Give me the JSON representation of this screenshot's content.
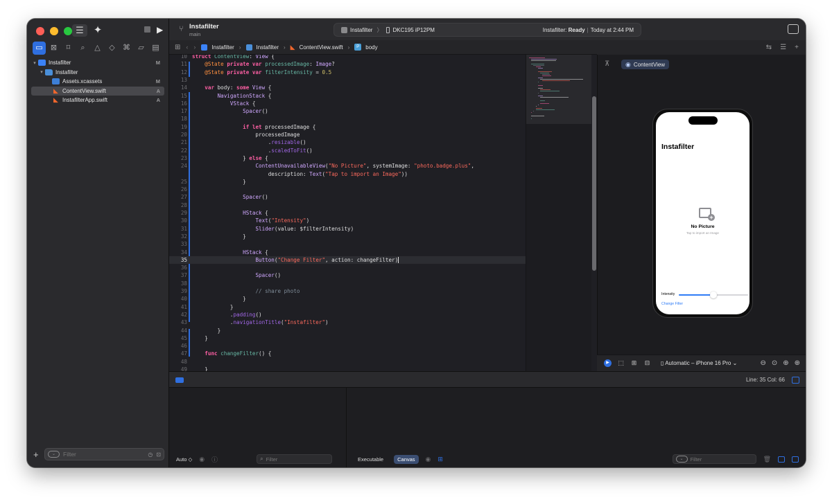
{
  "sidebar": {
    "tree": [
      {
        "label": "Instafilter",
        "icon": "project-icon",
        "badge": "M",
        "depth": 0,
        "expanded": true
      },
      {
        "label": "Instafilter",
        "icon": "folder-icon",
        "badge": "",
        "depth": 1,
        "expanded": true
      },
      {
        "label": "Assets.xcassets",
        "icon": "assets-icon",
        "badge": "M",
        "depth": 2
      },
      {
        "label": "ContentView.swift",
        "icon": "swift-file-icon",
        "badge": "A",
        "depth": 2,
        "selected": true
      },
      {
        "label": "InstafilterApp.swift",
        "icon": "swift-file-icon",
        "badge": "A",
        "depth": 2
      }
    ],
    "filter_placeholder": "Filter",
    "nav_icons": [
      "folder-icon",
      "source-control-icon",
      "bookmark-icon",
      "find-icon",
      "issue-icon",
      "test-icon",
      "debug-icon",
      "breakpoint-icon",
      "report-icon"
    ]
  },
  "toolbar": {
    "project_title": "Instafilter",
    "branch": "main",
    "scheme": "Instafilter",
    "device": "DKC195 iP12PM",
    "status_prefix": "Instafilter:",
    "status_state": "Ready",
    "status_time": "Today at 2:44 PM"
  },
  "jumpbar": {
    "crumbs": [
      "Instafilter",
      "Instafilter",
      "ContentView.swift",
      "body"
    ]
  },
  "editor": {
    "current_line": 35,
    "lines": [
      {
        "n": 10,
        "text": "struct ContentView: View {"
      },
      {
        "n": 11,
        "text": "    @State private var processedImage: Image?"
      },
      {
        "n": 12,
        "text": "    @State private var filterIntensity = 0.5"
      },
      {
        "n": 13,
        "text": ""
      },
      {
        "n": 14,
        "text": "    var body: some View {"
      },
      {
        "n": 15,
        "text": "        NavigationStack {"
      },
      {
        "n": 16,
        "text": "            VStack {"
      },
      {
        "n": 17,
        "text": "                Spacer()"
      },
      {
        "n": 18,
        "text": ""
      },
      {
        "n": 19,
        "text": "                if let processedImage {"
      },
      {
        "n": 20,
        "text": "                    processedImage"
      },
      {
        "n": 21,
        "text": "                        .resizable()"
      },
      {
        "n": 22,
        "text": "                        .scaledToFit()"
      },
      {
        "n": 23,
        "text": "                } else {"
      },
      {
        "n": 24,
        "text": "                    ContentUnavailableView(\"No Picture\", systemImage: \"photo.badge.plus\","
      },
      {
        "n": null,
        "text": "                        description: Text(\"Tap to import an Image\"))"
      },
      {
        "n": 25,
        "text": "                }"
      },
      {
        "n": 26,
        "text": ""
      },
      {
        "n": 27,
        "text": "                Spacer()"
      },
      {
        "n": 28,
        "text": ""
      },
      {
        "n": 29,
        "text": "                HStack {"
      },
      {
        "n": 30,
        "text": "                    Text(\"Intensity\")"
      },
      {
        "n": 31,
        "text": "                    Slider(value: $filterIntensity)"
      },
      {
        "n": 32,
        "text": "                }"
      },
      {
        "n": 33,
        "text": ""
      },
      {
        "n": 34,
        "text": "                HStack {"
      },
      {
        "n": 35,
        "text": "                    Button(\"Change Filter\", action: changeFilter)"
      },
      {
        "n": 36,
        "text": ""
      },
      {
        "n": 37,
        "text": "                    Spacer()"
      },
      {
        "n": 38,
        "text": ""
      },
      {
        "n": 39,
        "text": "                    // share photo"
      },
      {
        "n": 40,
        "text": "                }"
      },
      {
        "n": 41,
        "text": "            }"
      },
      {
        "n": 42,
        "text": "            .padding()"
      },
      {
        "n": 43,
        "text": "            .navigationTitle(\"Instafilter\")"
      },
      {
        "n": 44,
        "text": "        }"
      },
      {
        "n": 45,
        "text": "    }"
      },
      {
        "n": 46,
        "text": ""
      },
      {
        "n": 47,
        "text": "    func changeFilter() {"
      },
      {
        "n": 48,
        "text": ""
      },
      {
        "n": 49,
        "text": "    }"
      }
    ]
  },
  "canvas": {
    "preview_tab": "ContentView",
    "nav_title": "Instafilter",
    "unavailable_title": "No Picture",
    "unavailable_desc": "Tap to import an Image",
    "intensity_label": "Intensity",
    "intensity_value": 0.5,
    "change_filter_label": "Change Filter",
    "device_label": "Automatic – iPhone 16 Pro"
  },
  "debug": {
    "line_col": "Line: 35  Col: 66",
    "auto_label": "Auto ◇",
    "var_filter_placeholder": "Filter",
    "executable_label": "Executable",
    "canvas_label": "Canvas",
    "console_filter_placeholder": "Filter"
  },
  "colors": {
    "accent": "#2f6fe0",
    "keyword": "#fc5fa3",
    "string": "#fc6a5d",
    "type": "#d0a8ff"
  }
}
